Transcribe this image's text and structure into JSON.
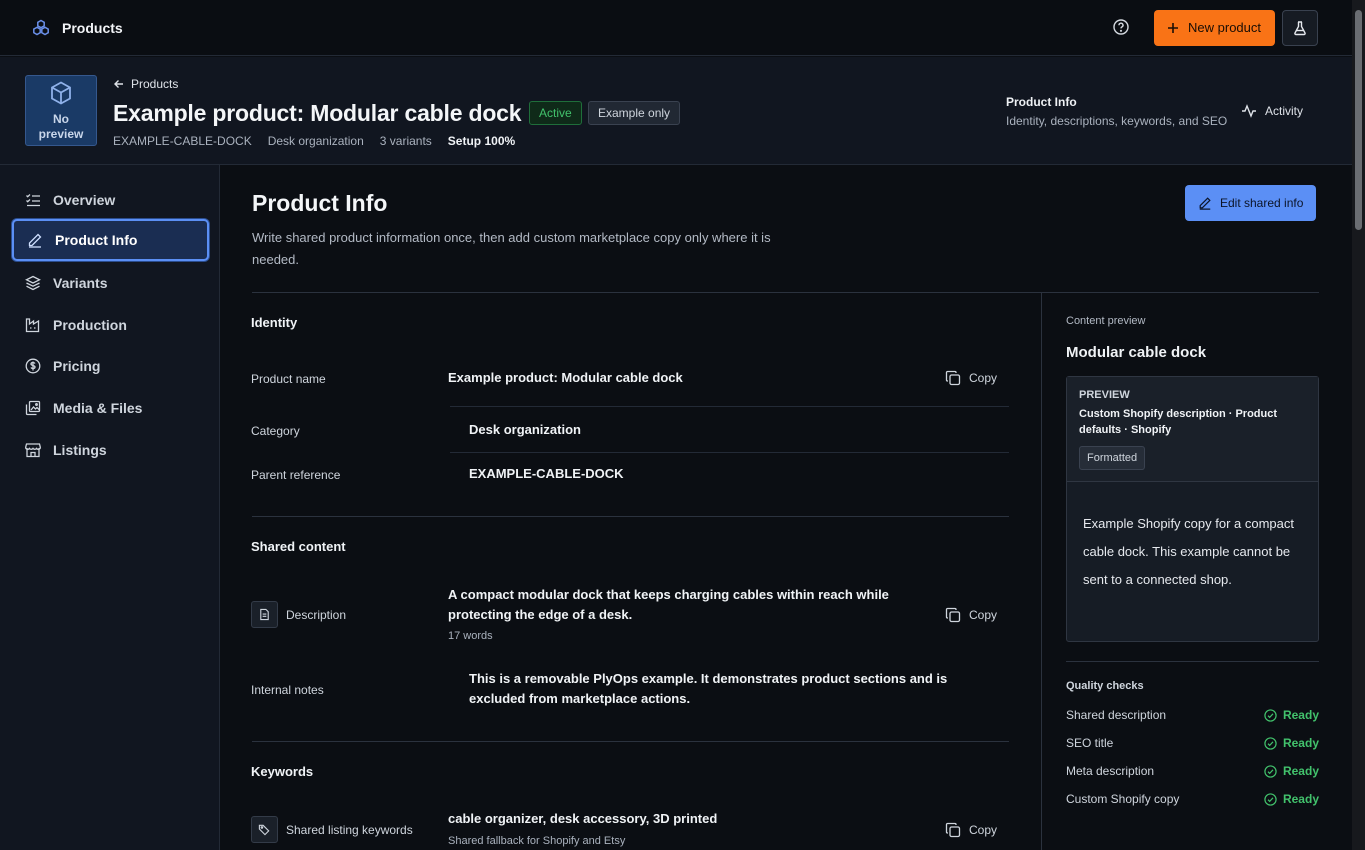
{
  "topbar": {
    "title": "Products",
    "new_product_label": "New product"
  },
  "header": {
    "thumb_text_1": "No",
    "thumb_text_2": "preview",
    "back_label": "Products",
    "product_title": "Example product: Modular cable dock",
    "status_badge": "Active",
    "example_badge": "Example only",
    "sku": "EXAMPLE-CABLE-DOCK",
    "category": "Desk organization",
    "variants": "3 variants",
    "setup": "Setup 100%",
    "section_title": "Product Info",
    "section_subtitle": "Identity, descriptions, keywords, and SEO",
    "activity_label": "Activity"
  },
  "sidebar": {
    "items": [
      {
        "label": "Overview",
        "icon": "list-check-icon"
      },
      {
        "label": "Product Info",
        "icon": "pencil-icon"
      },
      {
        "label": "Variants",
        "icon": "layers-icon"
      },
      {
        "label": "Production",
        "icon": "factory-icon"
      },
      {
        "label": "Pricing",
        "icon": "dollar-icon"
      },
      {
        "label": "Media & Files",
        "icon": "images-icon"
      },
      {
        "label": "Listings",
        "icon": "store-icon"
      }
    ],
    "active": "Product Info"
  },
  "main": {
    "title": "Product Info",
    "description": "Write shared product information once, then add custom marketplace copy only where it is needed.",
    "edit_button": "Edit shared info",
    "copy_label": "Copy",
    "identity": {
      "title": "Identity",
      "product_name_label": "Product name",
      "product_name_value": "Example product: Modular cable dock",
      "category_label": "Category",
      "category_value": "Desk organization",
      "parent_label": "Parent reference",
      "parent_value": "EXAMPLE-CABLE-DOCK"
    },
    "shared_content": {
      "title": "Shared content",
      "description_label": "Description",
      "description_value": "A compact modular dock that keeps charging cables within reach while protecting the edge of a desk.",
      "description_words": "17 words",
      "notes_label": "Internal notes",
      "notes_value": "This is a removable PlyOps example. It demonstrates product sections and is excluded from marketplace actions."
    },
    "keywords": {
      "title": "Keywords",
      "label": "Shared listing keywords",
      "value": "cable organizer, desk accessory, 3D printed",
      "sub": "Shared fallback for Shopify and Etsy"
    }
  },
  "right_panel": {
    "label": "Content preview",
    "title": "Modular cable dock",
    "preview": {
      "kicker": "PREVIEW",
      "name": "Custom Shopify description · Product defaults · Shopify",
      "badge": "Formatted",
      "body": "Example Shopify copy for a compact cable dock. This example cannot be sent to a connected shop."
    },
    "quality_title": "Quality checks",
    "checks": [
      {
        "label": "Shared description",
        "status": "Ready"
      },
      {
        "label": "SEO title",
        "status": "Ready"
      },
      {
        "label": "Meta description",
        "status": "Ready"
      },
      {
        "label": "Custom Shopify copy",
        "status": "Ready"
      }
    ],
    "status_color": "#42c26c"
  },
  "colors": {
    "accent_orange": "#f97316",
    "accent_blue": "#5b8ff5",
    "background": "#0b0e13"
  }
}
